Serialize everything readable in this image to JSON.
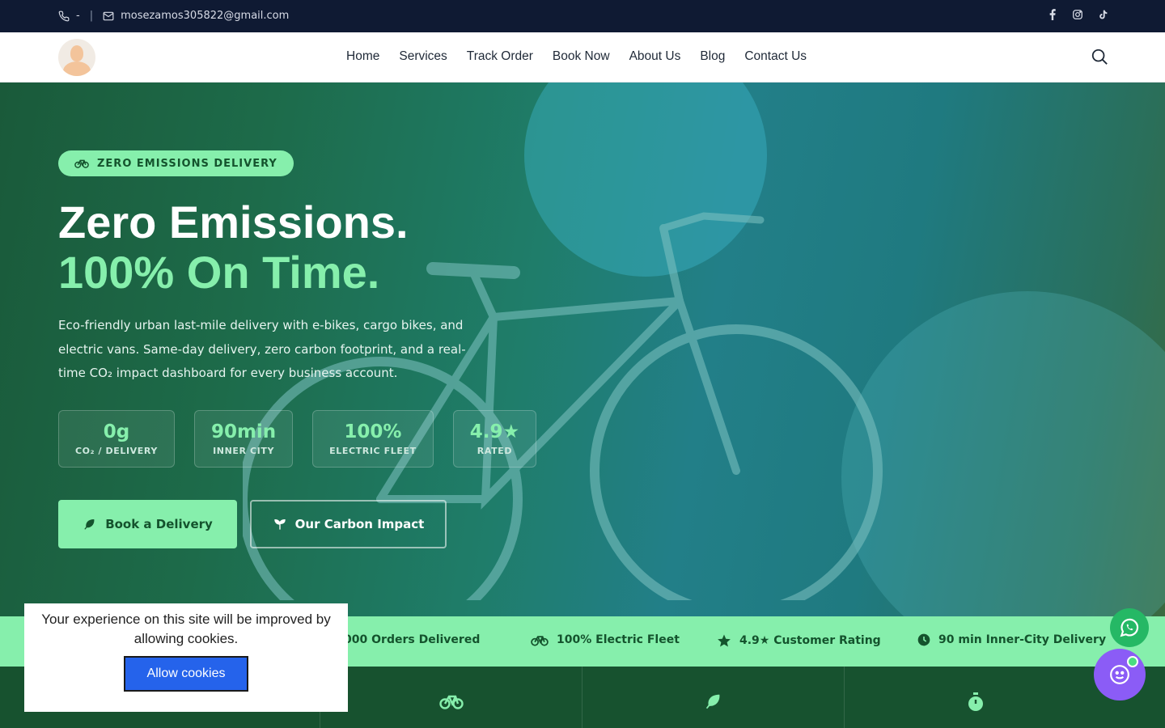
{
  "topbar": {
    "phone": "-",
    "separator": "|",
    "email": "mosezamos305822@gmail.com",
    "social_icons": [
      "facebook-icon",
      "instagram-icon",
      "tiktok-icon"
    ]
  },
  "nav": {
    "items": [
      "Home",
      "Services",
      "Track Order",
      "Book Now",
      "About Us",
      "Blog",
      "Contact Us"
    ]
  },
  "hero": {
    "badge": "ZERO EMISSIONS DELIVERY",
    "title_line1": "Zero Emissions.",
    "title_line2": "100% On Time.",
    "description": "Eco-friendly urban last-mile delivery with e-bikes, cargo bikes, and electric vans. Same-day delivery, zero carbon footprint, and a real-time CO₂ impact dashboard for every business account.",
    "stats": [
      {
        "value": "0g",
        "label": "CO₂ / DELIVERY"
      },
      {
        "value": "90min",
        "label": "INNER CITY"
      },
      {
        "value": "100%",
        "label": "ELECTRIC FLEET"
      },
      {
        "value": "4.9★",
        "label": "RATED"
      }
    ],
    "primary_button": "Book a Delivery",
    "secondary_button": "Our Carbon Impact"
  },
  "strip": {
    "items": [
      "4,000 Orders Delivered",
      "100% Electric Fleet",
      "4.9★ Customer Rating",
      "90 min Inner-City Delivery"
    ]
  },
  "cookie": {
    "message": "Your experience on this site will be improved by allowing cookies.",
    "button": "Allow cookies"
  },
  "colors": {
    "accent": "#86efac",
    "dark_green": "#14532d",
    "topbar": "#0f1a33",
    "chat": "#8b5cf6",
    "whatsapp": "#25b865",
    "cookie_button": "#2563eb"
  }
}
